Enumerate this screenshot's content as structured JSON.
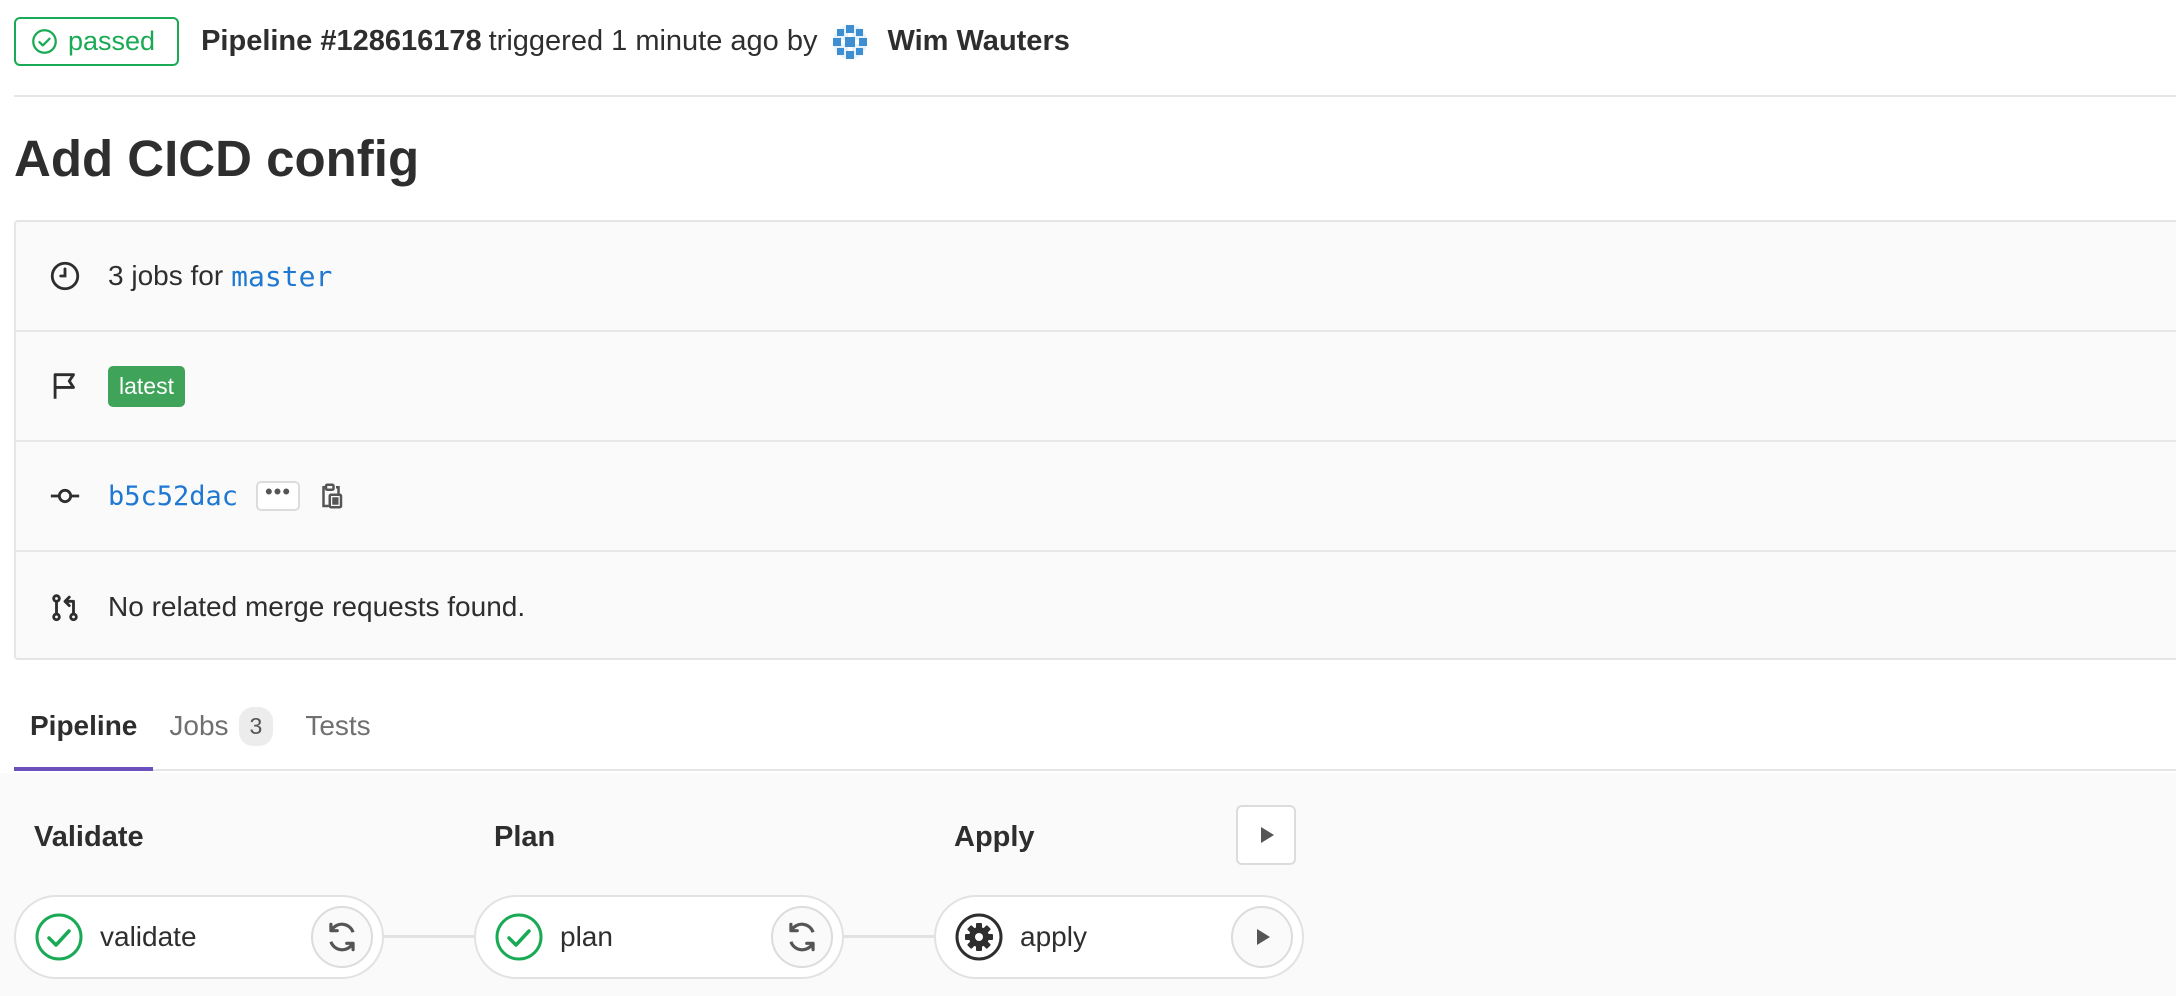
{
  "header": {
    "status": "passed",
    "pipeline_label": "Pipeline #128616178",
    "triggered_text": "triggered 1 minute ago by",
    "author": "Wim Wauters"
  },
  "title": "Add CICD config",
  "info": {
    "jobs_text": "3 jobs for",
    "branch": "master",
    "tag": "latest",
    "commit_sha": "b5c52dac",
    "ellipsis": "•••",
    "merge_requests": "No related merge requests found."
  },
  "tabs": [
    {
      "label": "Pipeline",
      "active": true
    },
    {
      "label": "Jobs",
      "count": "3",
      "active": false
    },
    {
      "label": "Tests",
      "active": false
    }
  ],
  "stages": [
    {
      "title": "Validate",
      "job": {
        "name": "validate",
        "status": "success",
        "action": "retry-icon"
      }
    },
    {
      "title": "Plan",
      "job": {
        "name": "plan",
        "status": "success",
        "action": "retry-icon"
      }
    },
    {
      "title": "Apply",
      "job": {
        "name": "apply",
        "status": "manual",
        "action": "play-icon"
      }
    }
  ],
  "colors": {
    "success": "#1aaa55",
    "link": "#1f78d1",
    "tag": "#3fa35a",
    "active_tab": "#6b4fbb"
  }
}
